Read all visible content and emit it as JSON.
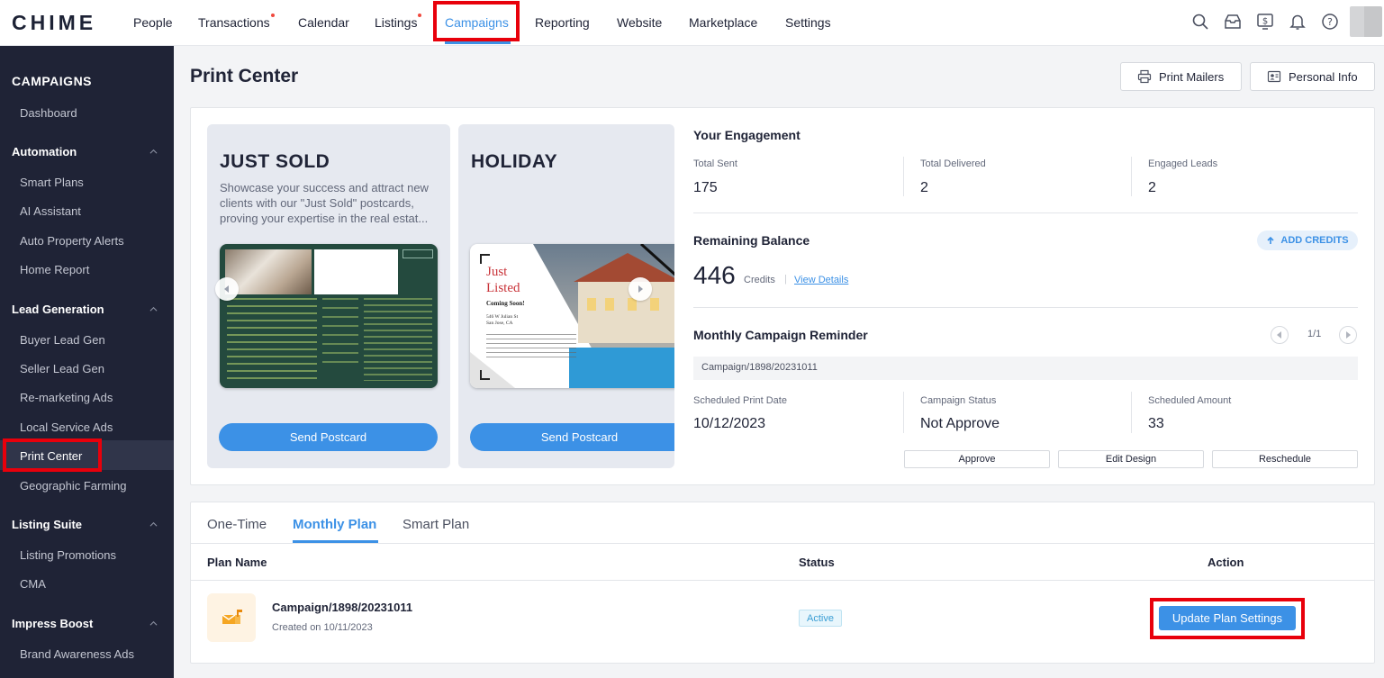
{
  "brand": {
    "logo": "CHIME"
  },
  "nav": {
    "items": [
      {
        "label": "People"
      },
      {
        "label": "Transactions"
      },
      {
        "label": "Calendar"
      },
      {
        "label": "Listings"
      },
      {
        "label": "Campaigns"
      },
      {
        "label": "Reporting"
      },
      {
        "label": "Website"
      },
      {
        "label": "Marketplace"
      },
      {
        "label": "Settings"
      }
    ],
    "active": "Campaigns",
    "icons": [
      "search-icon",
      "inbox-icon",
      "billing-icon",
      "bell-icon",
      "help-icon"
    ]
  },
  "sidebar": {
    "title": "CAMPAIGNS",
    "dashboard": "Dashboard",
    "sections": [
      {
        "label": "Automation",
        "items": [
          "Smart Plans",
          "AI Assistant",
          "Auto Property Alerts",
          "Home Report"
        ]
      },
      {
        "label": "Lead Generation",
        "items": [
          "Buyer Lead Gen",
          "Seller Lead Gen",
          "Re-marketing Ads",
          "Local Service Ads",
          "Print Center",
          "Geographic Farming"
        ]
      },
      {
        "label": "Listing Suite",
        "items": [
          "Listing Promotions",
          "CMA"
        ]
      },
      {
        "label": "Impress Boost",
        "items": [
          "Brand Awareness Ads"
        ]
      }
    ],
    "active": "Print Center"
  },
  "page": {
    "title": "Print Center",
    "print_mailers": "Print Mailers",
    "personal_info": "Personal Info"
  },
  "templates": [
    {
      "title": "JUST SOLD",
      "description": "Showcase your success and attract new clients with our \"Just Sold\" postcards, proving your expertise in the real estat...",
      "button": "Send Postcard"
    },
    {
      "title": "HOLIDAY",
      "description": "",
      "button": "Send Postcard",
      "preview": {
        "headline1": "Just",
        "headline2": "Listed",
        "sub": "Coming Soon!",
        "addr1": "546 W Julian St",
        "addr2": "San Jose, CA"
      }
    }
  ],
  "engagement": {
    "title": "Your Engagement",
    "stats": [
      {
        "label": "Total Sent",
        "value": "175"
      },
      {
        "label": "Total Delivered",
        "value": "2"
      },
      {
        "label": "Engaged Leads",
        "value": "2"
      }
    ]
  },
  "balance": {
    "title": "Remaining Balance",
    "amount": "446",
    "unit": "Credits",
    "sep": "|",
    "view_details": "View Details",
    "add_credits": "ADD CREDITS"
  },
  "reminder": {
    "title": "Monthly Campaign Reminder",
    "pager": "1/1",
    "campaign": "Campaign/1898/20231011",
    "fields": [
      {
        "label": "Scheduled Print Date",
        "value": "10/12/2023"
      },
      {
        "label": "Campaign Status",
        "value": "Not Approve"
      },
      {
        "label": "Scheduled Amount",
        "value": "33"
      }
    ],
    "buttons": [
      "Approve",
      "Edit Design",
      "Reschedule"
    ]
  },
  "plans": {
    "tabs": [
      "One-Time",
      "Monthly Plan",
      "Smart Plan"
    ],
    "active_tab": "Monthly Plan",
    "columns": [
      "Plan Name",
      "Status",
      "Action"
    ],
    "rows": [
      {
        "name": "Campaign/1898/20231011",
        "created": "Created on 10/11/2023",
        "status": "Active",
        "action": "Update Plan Settings"
      }
    ]
  },
  "colors": {
    "accent": "#3c91e6",
    "sidebar": "#1f2336",
    "highlight": "#e8000b"
  }
}
